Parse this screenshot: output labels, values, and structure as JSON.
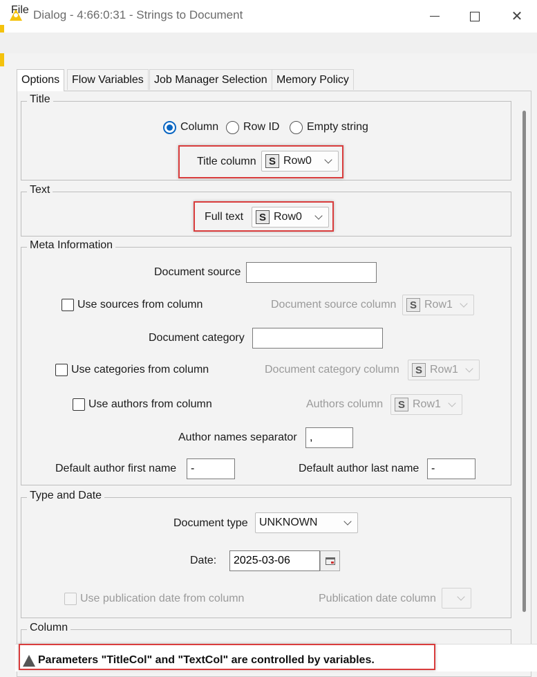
{
  "window": {
    "title": "Dialog - 4:66:0:31 - Strings to Document",
    "close_glyph": "✕",
    "app_icon": "knime-warning-triangle-icon"
  },
  "menu": {
    "file": "File"
  },
  "tabs": [
    {
      "label": "Options",
      "active": true
    },
    {
      "label": "Flow Variables"
    },
    {
      "label": "Job Manager Selection"
    },
    {
      "label": "Memory Policy"
    }
  ],
  "title_group": {
    "legend": "Title",
    "radio_column": "Column",
    "radio_rowid": "Row ID",
    "radio_empty": "Empty string",
    "selected": "Column",
    "title_column_label": "Title column",
    "title_column_value": "Row0"
  },
  "text_group": {
    "legend": "Text",
    "full_text_label": "Full text",
    "full_text_value": "Row0"
  },
  "meta_group": {
    "legend": "Meta Information",
    "doc_source_label": "Document source",
    "doc_source_value": "",
    "use_sources_label": "Use sources from column",
    "doc_source_column_label": "Document source column",
    "doc_source_column_value": "Row1",
    "doc_category_label": "Document category",
    "doc_category_value": "",
    "use_categories_label": "Use categories from column",
    "doc_category_column_label": "Document category column",
    "doc_category_column_value": "Row1",
    "use_authors_label": "Use authors from column",
    "authors_column_label": "Authors column",
    "authors_column_value": "Row1",
    "author_sep_label": "Author names separator",
    "author_sep_value": ",",
    "default_first_label": "Default author first name",
    "default_first_value": "-",
    "default_last_label": "Default author last name",
    "default_last_value": "-"
  },
  "type_group": {
    "legend": "Type and Date",
    "doc_type_label": "Document type",
    "doc_type_value": "UNKNOWN",
    "date_label": "Date:",
    "date_value": "2025-03-06",
    "use_pub_date_label": "Use publication date from column",
    "pub_date_column_label": "Publication date column"
  },
  "column_group": {
    "legend": "Column"
  },
  "type_icon": "S",
  "status": {
    "message": "Parameters \"TitleCol\" and \"TextCol\" are controlled by variables."
  },
  "colors": {
    "accent": "#0a66c2",
    "highlight": "#d93c3c",
    "app_yellow": "#f4c20d"
  }
}
